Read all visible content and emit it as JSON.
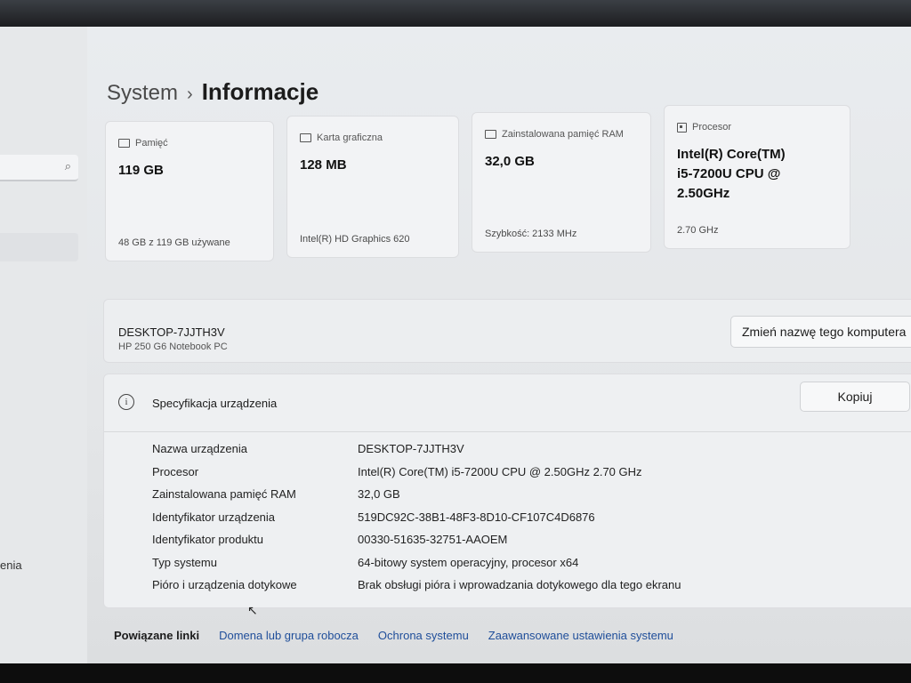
{
  "breadcrumb": {
    "parent": "System",
    "separator": "›",
    "current": "Informacje"
  },
  "sidebar": {
    "search_icon": "search-icon",
    "partial_label": "enia"
  },
  "cards": [
    {
      "title": "Pamięć",
      "icon": "storage-icon",
      "value": "119 GB",
      "sub": "48 GB z 119 GB używane"
    },
    {
      "title": "Karta graficzna",
      "icon": "gpu-icon",
      "value": "128 MB",
      "sub": "Intel(R) HD Graphics 620"
    },
    {
      "title": "Zainstalowana pamięć RAM",
      "icon": "ram-icon",
      "value": "32,0 GB",
      "sub": "Szybkość: 2133 MHz"
    },
    {
      "title": "Procesor",
      "icon": "cpu-icon",
      "value_lines": [
        "Intel(R) Core(TM)",
        "i5-7200U CPU @",
        "2.50GHz"
      ],
      "sub": "2.70 GHz"
    }
  ],
  "device": {
    "name": "DESKTOP-7JJTH3V",
    "model": "HP 250 G6 Notebook PC",
    "rename_label": "Zmień nazwę tego komputera"
  },
  "spec": {
    "title": "Specyfikacja urządzenia",
    "copy_label": "Kopiuj",
    "rows": [
      {
        "label": "Nazwa urządzenia",
        "value": "DESKTOP-7JJTH3V"
      },
      {
        "label": "Procesor",
        "value": "Intel(R) Core(TM) i5-7200U CPU @ 2.50GHz   2.70 GHz"
      },
      {
        "label": "Zainstalowana pamięć RAM",
        "value": "32,0 GB"
      },
      {
        "label": "Identyfikator urządzenia",
        "value": "519DC92C-38B1-48F3-8D10-CF107C4D6876"
      },
      {
        "label": "Identyfikator produktu",
        "value": "00330-51635-32751-AAOEM"
      },
      {
        "label": "Typ systemu",
        "value": "64-bitowy system operacyjny, procesor x64"
      },
      {
        "label": "Pióro i urządzenia dotykowe",
        "value": "Brak obsługi pióra i wprowadzania dotykowego dla tego ekranu"
      }
    ]
  },
  "related": {
    "title": "Powiązane linki",
    "links": [
      "Domena lub grupa robocza",
      "Ochrona systemu",
      "Zaawansowane ustawienia systemu"
    ]
  }
}
